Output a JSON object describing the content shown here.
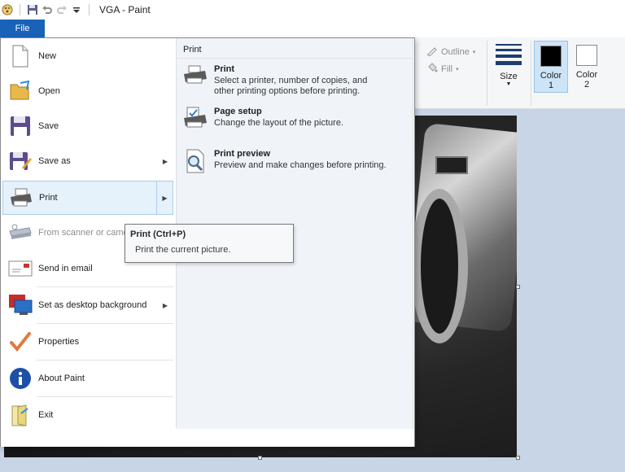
{
  "window": {
    "title": "VGA - Paint"
  },
  "tabs": {
    "file": "File"
  },
  "ribbon": {
    "outline_label": "Outline",
    "fill_label": "Fill",
    "size_label": "Size",
    "color1_label_line1": "Color",
    "color1_label_line2": "1",
    "color2_label_line1": "Color",
    "color2_label_line2": "2",
    "color1_hex": "#000000",
    "color2_hex": "#ffffff"
  },
  "file_menu": {
    "items": [
      {
        "label": "New"
      },
      {
        "label": "Open"
      },
      {
        "label": "Save"
      },
      {
        "label": "Save as"
      },
      {
        "label": "Print"
      },
      {
        "label": "From scanner or came"
      },
      {
        "label": "Send in email"
      },
      {
        "label": "Set as desktop background"
      },
      {
        "label": "Properties"
      },
      {
        "label": "About Paint"
      },
      {
        "label": "Exit"
      }
    ],
    "submenu": {
      "header": "Print",
      "items": [
        {
          "title": "Print",
          "desc_line1": "Select a printer, number of copies, and",
          "desc_line2": "other printing options before printing."
        },
        {
          "title": "Page setup",
          "desc_line1": "Change the layout of the picture.",
          "desc_line2": ""
        },
        {
          "title": "Print preview",
          "desc_line1": "Preview and make changes before printing.",
          "desc_line2": ""
        }
      ]
    }
  },
  "tooltip": {
    "title": "Print (Ctrl+P)",
    "desc": "Print the current picture."
  },
  "colors": {
    "accent": "#1a62b8",
    "highlight": "#e5f1fb",
    "submenu_bg": "#f0f4f9"
  }
}
